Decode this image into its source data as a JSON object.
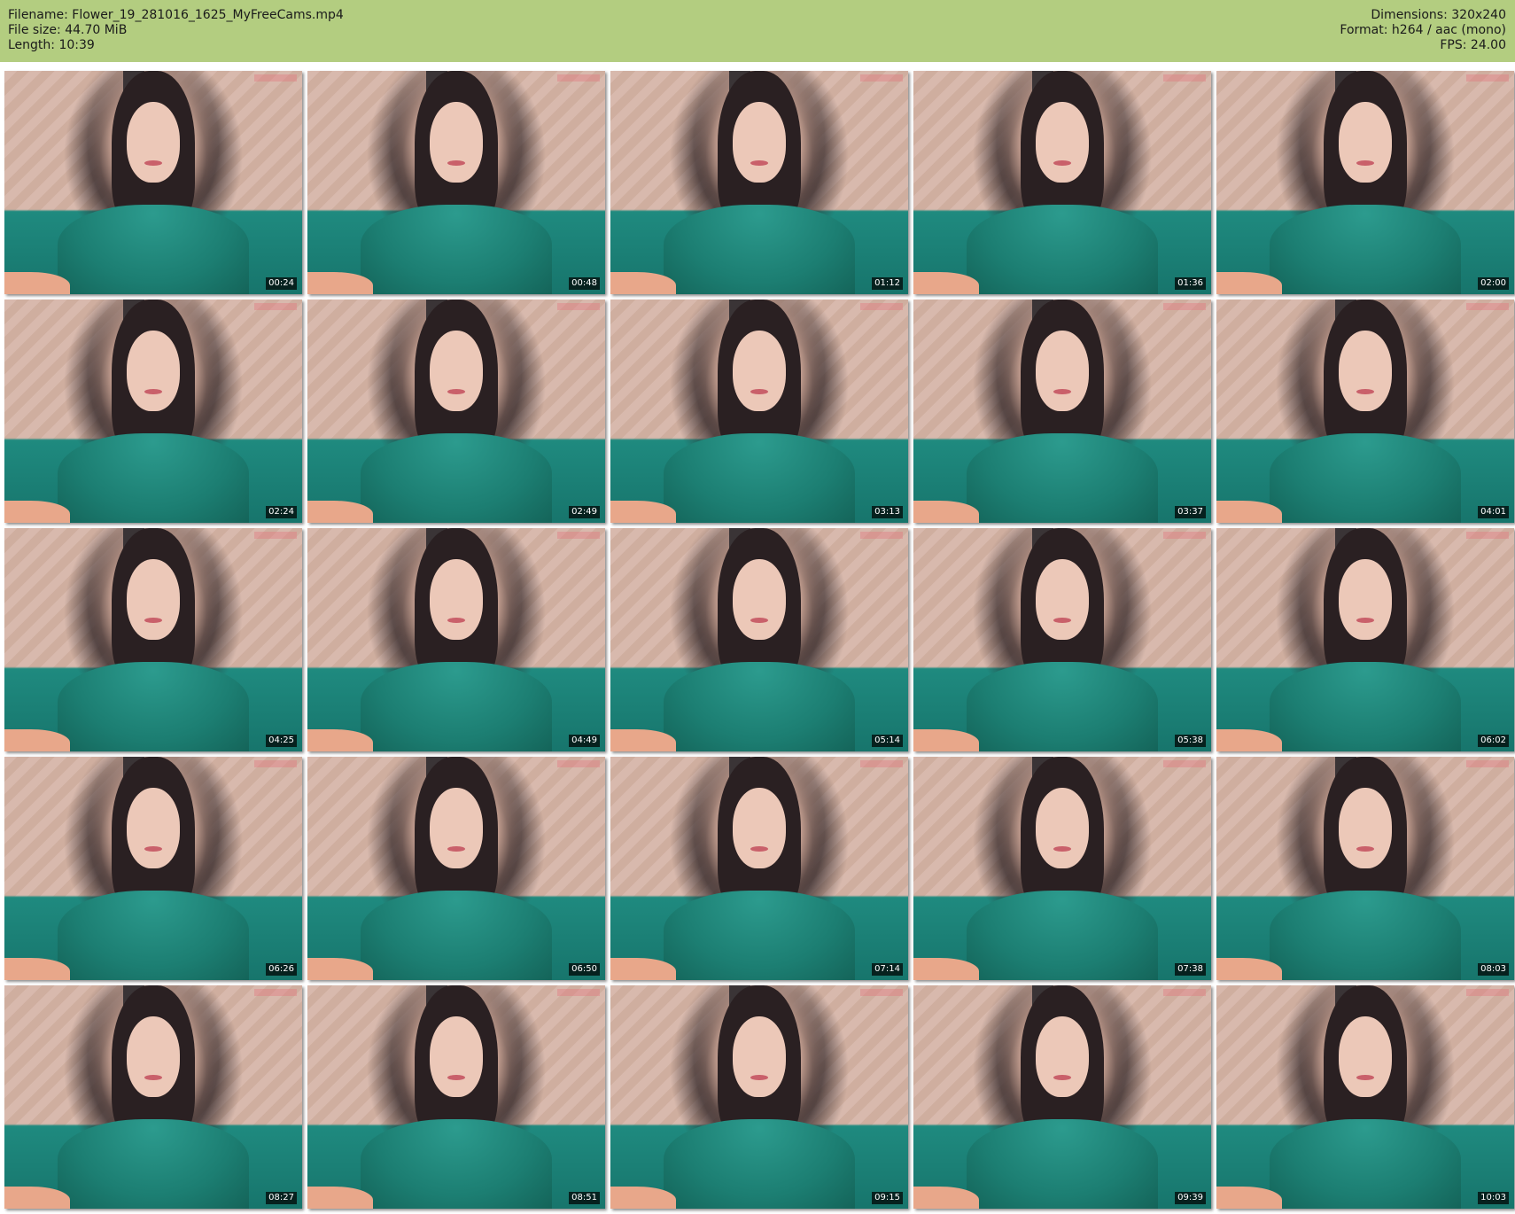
{
  "header": {
    "left": [
      "Filename: Flower_19_281016_1625_MyFreeCams.mp4",
      "File size: 44.70 MiB",
      "Length: 10:39"
    ],
    "right": [
      "Dimensions: 320x240",
      "Format: h264 / aac (mono)",
      "FPS: 24.00"
    ]
  },
  "thumbnails": [
    "00:24",
    "00:48",
    "01:12",
    "01:36",
    "02:00",
    "02:24",
    "02:49",
    "03:13",
    "03:37",
    "04:01",
    "04:25",
    "04:49",
    "05:14",
    "05:38",
    "06:02",
    "06:26",
    "06:50",
    "07:14",
    "07:38",
    "08:03",
    "08:27",
    "08:51",
    "09:15",
    "09:39",
    "10:03"
  ]
}
